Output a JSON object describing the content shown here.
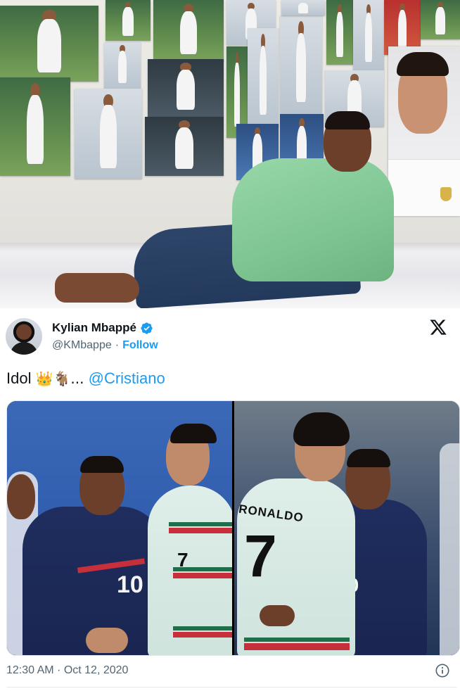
{
  "tweet": {
    "author": {
      "name": "Kylian Mbappé",
      "handle": "@KMbappe",
      "separator": "·",
      "follow_label": "Follow",
      "verified": true
    },
    "text_prefix": "Idol",
    "emojis": "👑🐐...",
    "mention": "@Cristiano",
    "timestamp": "12:30 AM · Oct 12, 2020",
    "platform_logo": "x-logo-icon"
  },
  "media": {
    "left_photo": {
      "shirt_number_france": "10",
      "shirt_number_portugal": "7"
    },
    "right_photo": {
      "shirt_name": "RONALDO",
      "shirt_number_portugal": "7",
      "shirt_number_france": "10"
    }
  },
  "colors": {
    "link_blue": "#1d9bf0",
    "verified_blue": "#1d9bf0",
    "text_primary": "#0f1419",
    "text_secondary": "#536471",
    "hoodie_green": "#7ec592",
    "france_navy": "#1f2e5f",
    "portugal_mint": "#dfeee9"
  }
}
